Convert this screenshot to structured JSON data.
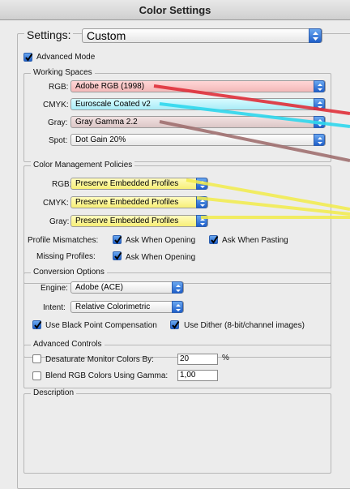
{
  "window": {
    "title": "Color Settings"
  },
  "settings": {
    "label": "Settings:",
    "value": "Custom"
  },
  "advanced_mode": {
    "label": "Advanced Mode",
    "checked": true
  },
  "working_spaces": {
    "legend": "Working Spaces",
    "rgb": {
      "label": "RGB:",
      "value": "Adobe RGB (1998)"
    },
    "cmyk": {
      "label": "CMYK:",
      "value": "Euroscale Coated v2"
    },
    "gray": {
      "label": "Gray:",
      "value": "Gray Gamma 2.2"
    },
    "spot": {
      "label": "Spot:",
      "value": "Dot Gain 20%"
    }
  },
  "color_management_policies": {
    "legend": "Color Management Policies",
    "rgb": {
      "label": "RGB:",
      "value": "Preserve Embedded Profiles"
    },
    "cmyk": {
      "label": "CMYK:",
      "value": "Preserve Embedded Profiles"
    },
    "gray": {
      "label": "Gray:",
      "value": "Preserve Embedded Profiles"
    },
    "profile_mismatches": {
      "label": "Profile Mismatches:",
      "ask_opening": {
        "label": "Ask When Opening",
        "checked": true
      },
      "ask_pasting": {
        "label": "Ask When Pasting",
        "checked": true
      }
    },
    "missing_profiles": {
      "label": "Missing Profiles:",
      "ask_opening": {
        "label": "Ask When Opening",
        "checked": true
      }
    }
  },
  "conversion_options": {
    "legend": "Conversion Options",
    "engine": {
      "label": "Engine:",
      "value": "Adobe (ACE)"
    },
    "intent": {
      "label": "Intent:",
      "value": "Relative Colorimetric"
    },
    "black_point": {
      "label": "Use Black Point Compensation",
      "checked": true
    },
    "dither": {
      "label": "Use Dither (8-bit/channel images)",
      "checked": true
    }
  },
  "advanced_controls": {
    "legend": "Advanced Controls",
    "desaturate": {
      "label": "Desaturate Monitor Colors By:",
      "value": "20",
      "unit": "%",
      "checked": false
    },
    "blend": {
      "label": "Blend RGB Colors Using Gamma:",
      "value": "1,00",
      "checked": false
    }
  },
  "description": {
    "legend": "Description"
  },
  "colors": {
    "highlight_red": "#e0303a",
    "highlight_cyan": "#2fd8ee",
    "highlight_rose": "#a07070",
    "highlight_yellow": "#f3ec4a",
    "accent_blue": "#1f5fc9"
  }
}
